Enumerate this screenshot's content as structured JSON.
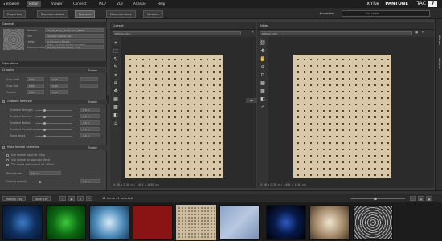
{
  "menu": [
    "Browser",
    "Editor",
    "Viewer",
    "Connect",
    "TAC7",
    "VLB",
    "Analyze",
    "Help"
  ],
  "active_menu": "Editor",
  "brand": {
    "xrite": "x·rite",
    "pantone": "PANTONE",
    "tac": "TAC",
    "tac_num": "7"
  },
  "tabs": [
    "Properties",
    "Representations",
    "Features",
    "Measurements",
    "Variants"
  ],
  "active_tab": "Features",
  "search": {
    "label": "Properties",
    "placeholder": "for table"
  },
  "general": {
    "title": "General",
    "material_label": "Material",
    "material_value": "SD_FR_Beige_Perforated_BTFR",
    "title_label": "Title",
    "title_value": "Sample Leather perf",
    "folder_label": "Folder",
    "folder_value": "C:\\Program Files\\X-Rite\\...\\ios\\Data\\Ext\\SampleMat",
    "rep_label": "Representations",
    "rep_value": "DEMO (SmartX Demo - 1.0)"
  },
  "operations": {
    "title": "Operations",
    "cropping": {
      "title": "Cropping",
      "enable": "Enable",
      "rows": [
        [
          "Crop Start",
          "0.00",
          "0.00"
        ],
        [
          "Crop Size",
          "0.00",
          "0.00"
        ],
        [
          "Position",
          "0.00",
          "0.00"
        ]
      ]
    },
    "gradient": {
      "title": "Gradient Removal",
      "enable": "Enable",
      "rows": [
        "Gradient Strength",
        "Gradient Amount",
        "Gradient Radius",
        "Gradient Smoothing",
        "Alpha Boost"
      ]
    },
    "gradient_values": [
      "0.0 %",
      "0.0 %",
      "0.0 %",
      "0.0 %",
      "0.0 %"
    ],
    "normals": {
      "title": "Make Normal Seamless",
      "enable": "Enable",
      "options": [
        "Use normal input for tiling",
        "Use normal for specular blend",
        "Tile edges with normal for diffuse"
      ]
    },
    "blend": {
      "label": "Blend mode",
      "value": "Mix Go"
    },
    "extra": {
      "label": "Overlay opacity",
      "value": "0.0 %"
    }
  },
  "viewports": [
    {
      "title": "Current",
      "shader": "Diffuse Color",
      "status": "0.38 x 0.38 m | 1461 x 1461 px"
    },
    {
      "title": "Edited",
      "shader": "Diffuse Color",
      "status": "0.38 x 0.38 m | 1461 x 1461 px"
    }
  ],
  "right_sidebar": [
    "Aliases",
    "Variants"
  ],
  "filmbar": {
    "favorites": "Material Tray",
    "save": "Save Tray",
    "count": "13 items - 1 selected"
  },
  "thumbnails": [
    "blue-glow",
    "green-glow",
    "sky-glow",
    "red-solid",
    "perforated-leather",
    "blue-texture",
    "dark-blue-glow",
    "tan-glow",
    "swirl-pattern"
  ],
  "colors": {
    "bg": "#3b3b3b",
    "panel": "#404040",
    "accent": "#c9b896"
  }
}
